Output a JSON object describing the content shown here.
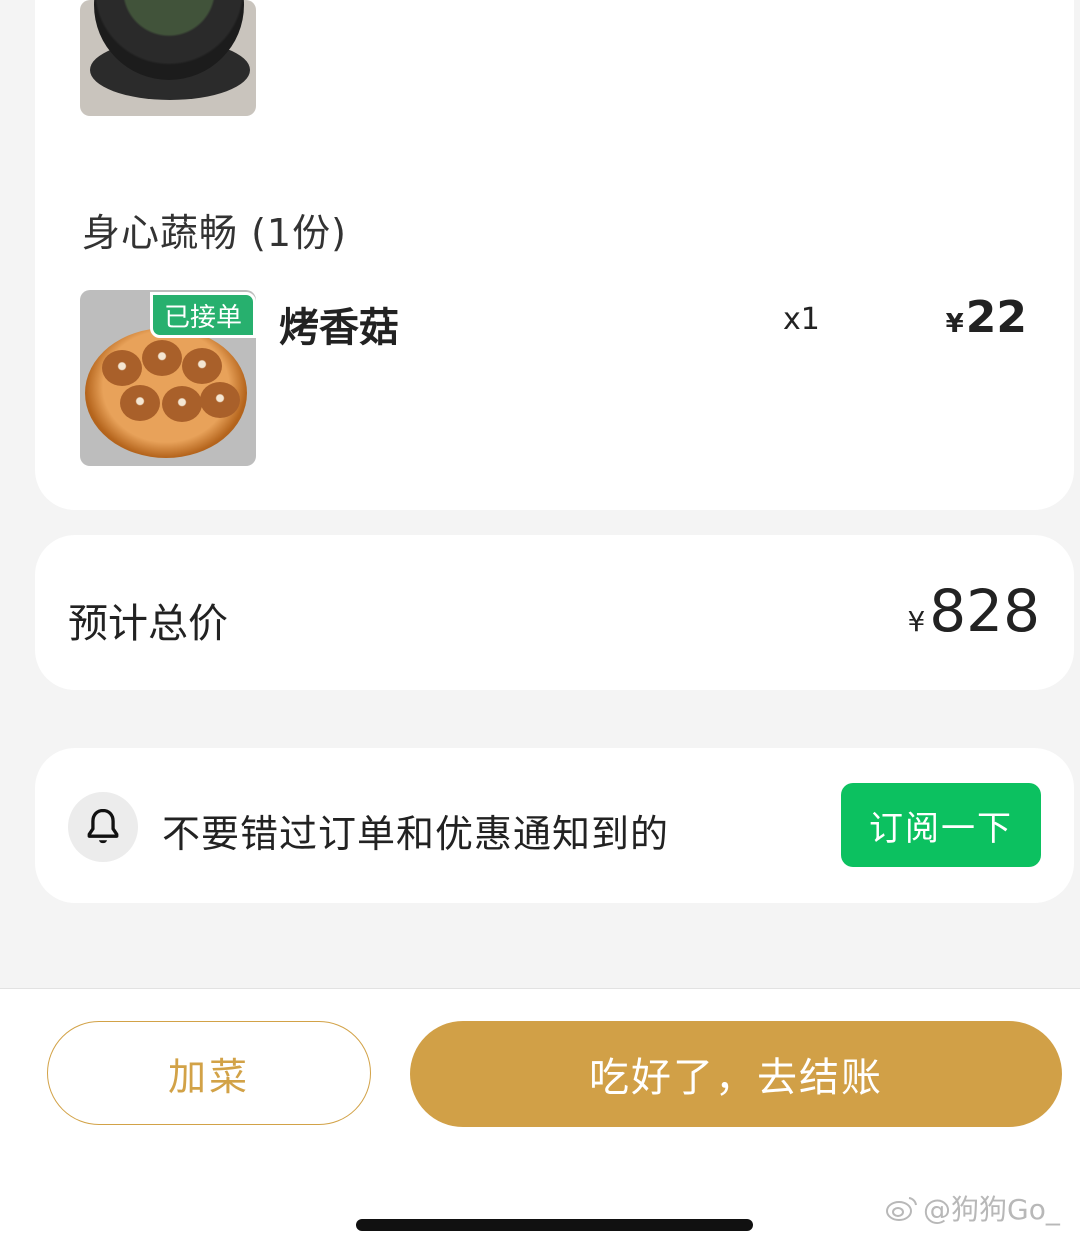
{
  "order": {
    "section_title": "身心蔬畅 (1份)",
    "item": {
      "status_badge": "已接单",
      "name": "烤香菇",
      "quantity": "x1",
      "currency": "¥",
      "price": "22"
    }
  },
  "total": {
    "label": "预计总价",
    "currency": "¥",
    "amount": "828"
  },
  "notification": {
    "icon": "bell-icon",
    "text": "不要错过订单和优惠通知到的",
    "button_label": "订阅一下"
  },
  "bottom_bar": {
    "add_label": "加菜",
    "checkout_label": "吃好了，去结账"
  },
  "watermark": {
    "text": "@狗狗Go_"
  },
  "colors": {
    "gold": "#d1a047",
    "green_button": "#0cc160",
    "green_badge": "#27b06e"
  }
}
